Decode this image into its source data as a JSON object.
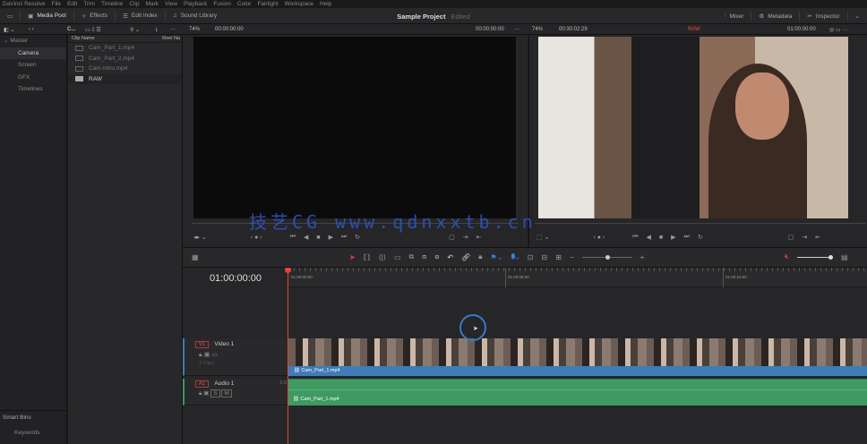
{
  "menu": [
    "DaVinci Resolve",
    "File",
    "Edit",
    "Trim",
    "Timeline",
    "Clip",
    "Mark",
    "View",
    "Playback",
    "Fusion",
    "Color",
    "Fairlight",
    "Workspace",
    "Help"
  ],
  "toolbar": {
    "media_pool": "Media Pool",
    "effects": "Effects",
    "edit_index": "Edit Index",
    "sound_library": "Sound Library",
    "project": "Sample Project",
    "status": "Edited",
    "mixer": "Mixer",
    "metadata": "Metadata",
    "inspector": "Inspector"
  },
  "subbar": {
    "bin_short": "C...",
    "src_zoom": "74%",
    "src_tc_in": "00:00:00:00",
    "src_tc": "00:00:00:00",
    "tl_zoom": "74%",
    "tl_duration": "00:30:02:29",
    "tl_name": "RAW",
    "tl_tc": "01:00:00:00"
  },
  "sidebar": {
    "master": "Master",
    "items": [
      "Camera",
      "Screen",
      "GFX",
      "Timelines"
    ],
    "smart_bins": "Smart Bins",
    "keywords": "Keywords"
  },
  "clips": {
    "col_name": "Clip Name",
    "col_reel": "Reel Na",
    "items": [
      "Cam_Part_1.mp4",
      "Cam_Part_2.mp4",
      "Cam-Intro.mp4",
      "RAW"
    ]
  },
  "timeline": {
    "timecode": "01:00:00:00",
    "ruler": [
      "01:00:00:00",
      "01:00:08:00",
      "01:00:16:00"
    ],
    "video_track": {
      "badge": "V1",
      "name": "Video 1",
      "clips": "3 Clips",
      "clip_name": "Cam_Part_1.mp4"
    },
    "audio_track": {
      "badge": "A1",
      "name": "Audio 1",
      "channels": "2.0",
      "solo": "S",
      "mute": "M",
      "clip_name": "Cam_Part_1.mp4"
    }
  },
  "watermark": "技艺CG www.qdnxxtb.cn",
  "colors": {
    "playhead": "#e0443a",
    "video_clip": "#3f7cb8",
    "audio_clip": "#3f9a62",
    "raw": "#e0553a"
  }
}
